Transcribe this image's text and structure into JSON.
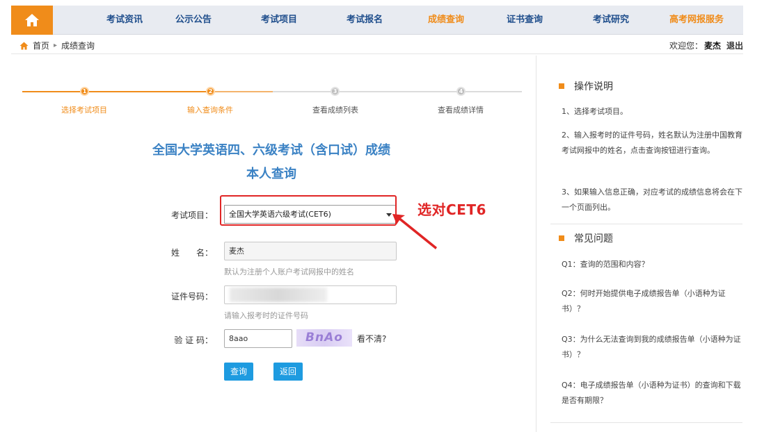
{
  "nav": {
    "items": [
      {
        "label": "考试资讯",
        "highlight": false
      },
      {
        "label": "公示公告",
        "highlight": false
      },
      {
        "label": "考试项目",
        "highlight": false
      },
      {
        "label": "考试报名",
        "highlight": false
      },
      {
        "label": "成绩查询",
        "highlight": true
      },
      {
        "label": "证书查询",
        "highlight": false
      },
      {
        "label": "考试研究",
        "highlight": false
      },
      {
        "label": "高考网报服务",
        "highlight": true
      }
    ]
  },
  "breadcrumb": {
    "home": "首页",
    "current": "成绩查询"
  },
  "welcome": {
    "prefix": "欢迎您：",
    "user": "麦杰",
    "logout": "退出"
  },
  "steps": [
    {
      "label": "选择考试项目",
      "active": true
    },
    {
      "label": "输入查询条件",
      "active": true
    },
    {
      "label": "查看成绩列表",
      "active": false
    },
    {
      "label": "查看成绩详情",
      "active": false
    }
  ],
  "title": {
    "line1": "全国大学英语四、六级考试（含口试）成绩",
    "line2": "本人查询"
  },
  "form": {
    "exam_label": "考试项目：",
    "exam_value": "全国大学英语六级考试(CET6)",
    "name_label": "姓　　名：",
    "name_value": "麦杰",
    "name_hint": "默认为注册个人账户考试网报中的姓名",
    "id_label": "证件号码：",
    "id_value": "",
    "id_hint": "请输入报考时的证件号码",
    "captcha_label": "验 证 码：",
    "captcha_value": "8aao",
    "captcha_image_text": "BnAo",
    "captcha_unclear": "看不清?",
    "query_button": "查询",
    "reset_button": "返回"
  },
  "annotation": "选对CET6",
  "sidebar": {
    "section1_title": "操作说明",
    "section1_items": [
      "1、选择考试项目。",
      "2、输入报考时的证件号码，姓名默认为注册中国教育考试网报中的姓名，点击查询按钮进行查询。",
      "3、如果输入信息正确，对应考试的成绩信息将会在下一个页面列出。"
    ],
    "section2_title": "常见问题",
    "section2_items": [
      "Q1：查询的范围和内容？",
      "Q2：何时开始提供电子成绩报告单（小语种为证书）？",
      "Q3：为什么无法查询到我的成绩报告单（小语种为证书）？",
      "Q4：电子成绩报告单（小语种为证书）的查询和下载是否有期限？"
    ]
  },
  "colors": {
    "accent": "#f08c1a",
    "link_blue": "#1f4e8c",
    "title_blue": "#3b82c4",
    "button_blue": "#1e9be0",
    "annotation_red": "#e02525"
  }
}
